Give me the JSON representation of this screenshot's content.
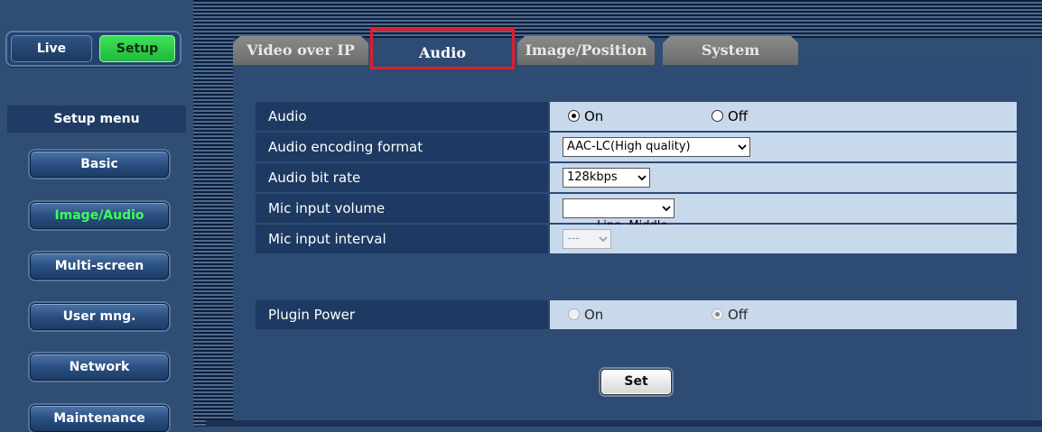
{
  "mode_switch": {
    "live_label": "Live",
    "setup_label": "Setup",
    "active": "Setup"
  },
  "sidebar": {
    "title": "Setup menu",
    "items": [
      {
        "label": "Basic",
        "active": false
      },
      {
        "label": "Image/Audio",
        "active": true
      },
      {
        "label": "Multi-screen",
        "active": false
      },
      {
        "label": "User mng.",
        "active": false
      },
      {
        "label": "Network",
        "active": false
      },
      {
        "label": "Maintenance",
        "active": false
      }
    ]
  },
  "tabs": [
    {
      "label": "Video over IP",
      "active": false
    },
    {
      "label": "Audio",
      "active": true
    },
    {
      "label": "Image/Position",
      "active": false
    },
    {
      "label": "System",
      "active": false
    }
  ],
  "settings": {
    "audio": {
      "label": "Audio",
      "on_label": "On",
      "off_label": "Off",
      "selected": "On"
    },
    "encoding": {
      "label": "Audio encoding format",
      "value": "AAC-LC(High quality)"
    },
    "bitrate": {
      "label": "Audio bit rate",
      "value": "128kbps"
    },
    "mic_volume": {
      "label": "Mic input volume",
      "value": "Line  Middle"
    },
    "mic_interval": {
      "label": "Mic input interval",
      "value": "---",
      "disabled": true
    },
    "plugin_power": {
      "label": "Plugin Power",
      "on_label": "On",
      "off_label": "Off",
      "selected": "Off",
      "disabled": true
    }
  },
  "set_button": "Set",
  "colors": {
    "active_tab_outline": "#e11d2a",
    "active_menu_text": "#3dff5b",
    "setup_button": "#2ecc4a"
  }
}
